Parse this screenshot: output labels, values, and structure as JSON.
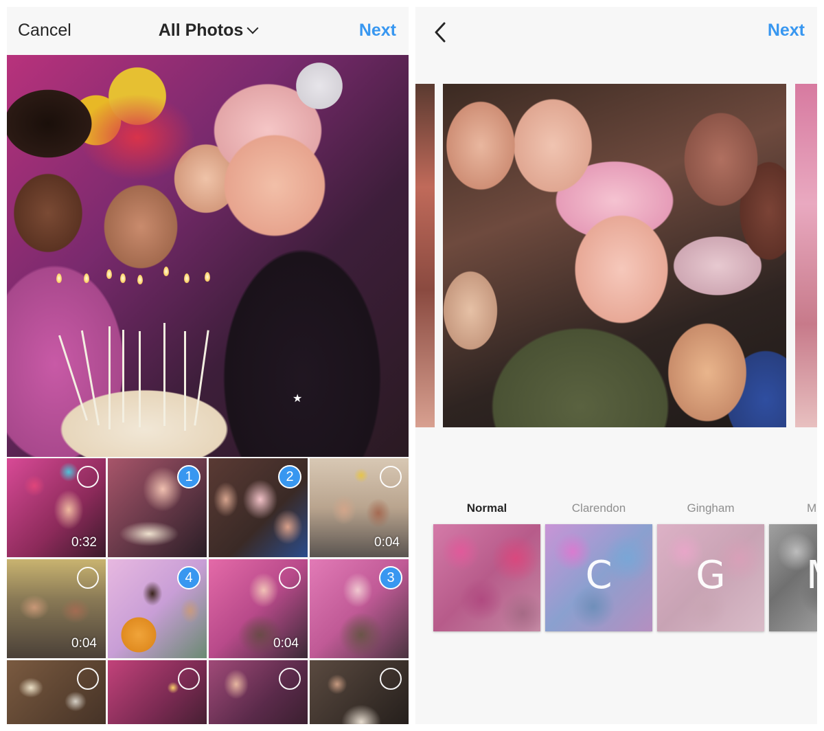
{
  "left": {
    "navbar": {
      "cancel_label": "Cancel",
      "title": "All Photos",
      "next_label": "Next"
    },
    "grid": {
      "tiles": [
        {
          "duration": "0:32",
          "selection": ""
        },
        {
          "duration": "",
          "selection": "1"
        },
        {
          "duration": "",
          "selection": "2"
        },
        {
          "duration": "0:04",
          "selection": ""
        },
        {
          "duration": "0:04",
          "selection": ""
        },
        {
          "duration": "",
          "selection": "4"
        },
        {
          "duration": "0:04",
          "selection": ""
        },
        {
          "duration": "",
          "selection": "3"
        },
        {
          "duration": "",
          "selection": ""
        },
        {
          "duration": "",
          "selection": ""
        },
        {
          "duration": "",
          "selection": ""
        },
        {
          "duration": "",
          "selection": ""
        }
      ]
    }
  },
  "right": {
    "navbar": {
      "next_label": "Next"
    },
    "filters": [
      {
        "label": "Normal",
        "letter": "",
        "active": true
      },
      {
        "label": "Clarendon",
        "letter": "C",
        "active": false
      },
      {
        "label": "Gingham",
        "letter": "G",
        "active": false
      },
      {
        "label": "M",
        "letter": "M",
        "active": false
      }
    ]
  },
  "colors": {
    "accent": "#3897f0",
    "text": "#262626",
    "muted": "#8e8e8e",
    "bar": "#f7f7f7"
  },
  "icons": {
    "dropdown": "chevron-down-icon",
    "back": "chevron-left-icon",
    "multi_select": "layers-icon"
  }
}
